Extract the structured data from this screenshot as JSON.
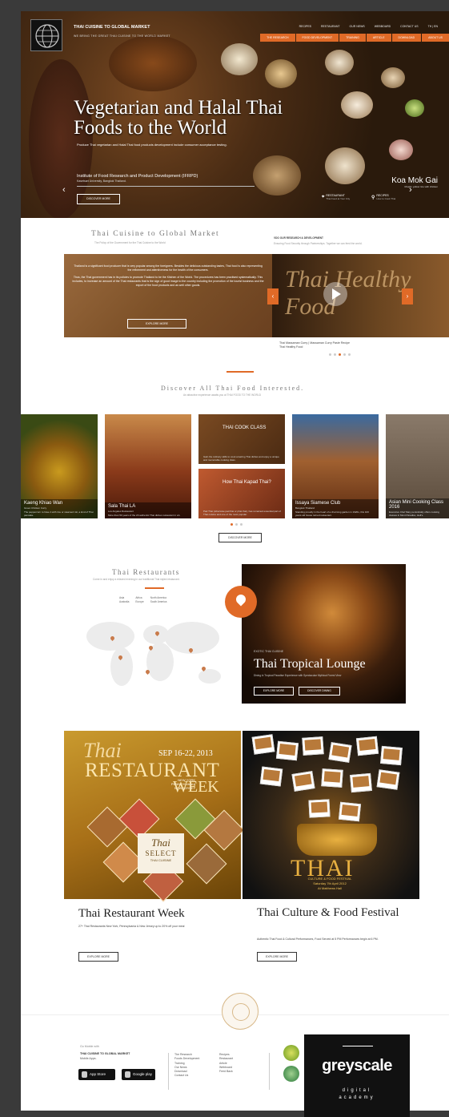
{
  "header": {
    "brand": "THAI CUISINE TO GLOBAL MARKET",
    "tagline": "WE BRING THE GREAT THAI CUISINE TO THE WORLD MARKET",
    "top_links": [
      "RECIPES",
      "RESTAURANT",
      "OUR NEWS",
      "WEBBOARD",
      "CONTACT US",
      "TH | EN"
    ],
    "nav": [
      "THE RESEARCH",
      "FOOD DEVELOPMENT",
      "TRAINING",
      "ARTICLE",
      "DOWNLOAD",
      "ABOUT US"
    ]
  },
  "hero": {
    "title": "Vegetarian and Halal Thai Foods to the World",
    "subtitle": "Produce Thai vegetarian and Halal Thai food products development include consumer acceptance testing.",
    "institute": "Institute of Food Research and Product Development (IFRPD)",
    "institute_sub": "Kasetsart University, Bangkok Thailand.",
    "button": "DISCOVER MORE",
    "dish": "Koa Mok Gai",
    "dish_sub": "Muslim yellow rice with chicken",
    "restaurant_label": "RESTAURANT",
    "restaurant_sub": "Thai Food at Your City",
    "recipes_label": "RECIPES",
    "recipes_sub": "How to Cook Thai"
  },
  "about": {
    "title": "Thai Cuisine to Global Market",
    "subtitle": "The Policy of the Government for the Thai Cuisine to the World",
    "para1": "Thailand is a significant food producer that is very popular among the foreigners. Besides the delicious outstanding tastes, Thai food is also representing the refinement and attentiveness for the health of the consumers.",
    "para2": "Thus, the Thai government has in its policies to promote Thailand to be the Kitchen of the World. The procedures has been practised systematically. This includes, to increase an amount of the Thai restaurants that is the sign of good image to the country including the promotion of the tourist business and the export of the food products and as well other goods.",
    "button": "EXPLORE MORE"
  },
  "video": {
    "heading": "VDO OUR RESEARCH & DEVELOPMENT",
    "subheading": "Ensuring Food Security through Partnerships. Together we can feed the world.",
    "overlay_text": "Thai Healthy Food",
    "caption1": "Thai Massaman Curry | Massaman Curry Paste Recipe",
    "caption2": "Thai Healthy Food"
  },
  "discover": {
    "title": "Discover All Thai Food Interested.",
    "subtitle": "An attractive experience awaits you at THAI FOOD TO THE WORLD",
    "button": "DISCOVER MORE",
    "cards": [
      {
        "title": "Kaeng Khiao Wan",
        "sub": "Green Chicken Curry",
        "desc": "The peppercorn to have it with rice or steamed roti, a kind of Thai pancake."
      },
      {
        "title": "Sala Thai LA",
        "sub": "Los Angeles Restaurant",
        "desc": "More than 50 years of the 20 authentic Thai dishes restaurant in LA."
      },
      {
        "title": "THAI COOK CLASS",
        "sub": "Thai Food Cookery Class",
        "desc": "Gain the culinary skills to cook amazing Thai dishes and enjoy a unique and memorable cooking class."
      },
      {
        "title": "How Thai Kapad Thai?",
        "sub": "Thai Food Recipe",
        "desc": "Pad Thai (otherwise pad thai or phat thai), has remained essential part of Thai cuisine and one of the most popular."
      },
      {
        "title": "Issaya Siamese Club",
        "sub": "Bangkok Thailand",
        "desc": "Standing proudly in the heart of a charming garden in 1920s, this 100 years old house turned restaurant."
      },
      {
        "title": "Asian Mini Cooking Class 2016",
        "sub": "",
        "desc": "Executive Chef Mary periodically offers cooking classes in Mont Paradiso, Hell's."
      }
    ]
  },
  "restaurants": {
    "title": "Thai Restaurants",
    "subtitle": "Come in and enjoy a relaxed evening in our traditional Thai styled restaurant.",
    "regions_col1": [
      "Asia",
      "Australia"
    ],
    "regions_col2": [
      "Africa",
      "Europe"
    ],
    "regions_col3": [
      "North America",
      "South America"
    ],
    "feature_kicker": "EXOTIC THAI CUISINE",
    "feature_title": "Thai Tropical Lounge",
    "feature_desc": "Dining in Tropical Paradise Experience with Spectacular Mythical Forest View",
    "btn_explore": "EXPLORE MORE",
    "btn_dining": "DISCOVER DINING"
  },
  "promo1": {
    "art_thai": "Thai",
    "art_date": "SEP 16-22, 2013",
    "art_restaurant": "RESTAURANT",
    "art_week": "WEEK",
    "art_cities": [
      "NEW YORK",
      "PENNSYLVANIA",
      "NEW JERSEY"
    ],
    "art_select1": "Thai",
    "art_select2": "SELECT",
    "art_select3": "THAI CUISINE",
    "title": "Thai Restaurant Week",
    "desc": "27+ Thai Restaurants New York, Pennsylvania & New Jersey up to 20% off your meal",
    "button": "EXPLORE MORE"
  },
  "promo2": {
    "art_thai": "THAI",
    "art_line1": "CULTURE & FOOD FESTIVAL",
    "art_line2": "Saturday 7th April 2012",
    "art_line3": "At Matthews Hall",
    "title": "Thai Culture & Food Festival",
    "desc": "Authentic Thai Food & Cultural Performances, Food Served at 5 PM Performances begin at 6 PM.",
    "button": "EXPLORE MORE"
  },
  "footer": {
    "go_mobile": "Go Mobile with",
    "app_name": "THAI CUISINE TO GLOBAL MARKET",
    "app_sub": "Mobile Apps.",
    "app_store": "App Store",
    "google_play": "Google play",
    "links_col1": [
      "The Research",
      "Foods Development",
      "Training",
      "Our News",
      "Download",
      "Contact Us"
    ],
    "links_col2": [
      "Recipes",
      "Restaurant",
      "Article",
      "Webboard",
      "Feed Back"
    ]
  },
  "watermark": {
    "name": "greyscale",
    "sub1": "digital",
    "sub2": "academy"
  },
  "colors": {
    "accent": "#e06a27",
    "frame": "#3a3a3a"
  }
}
